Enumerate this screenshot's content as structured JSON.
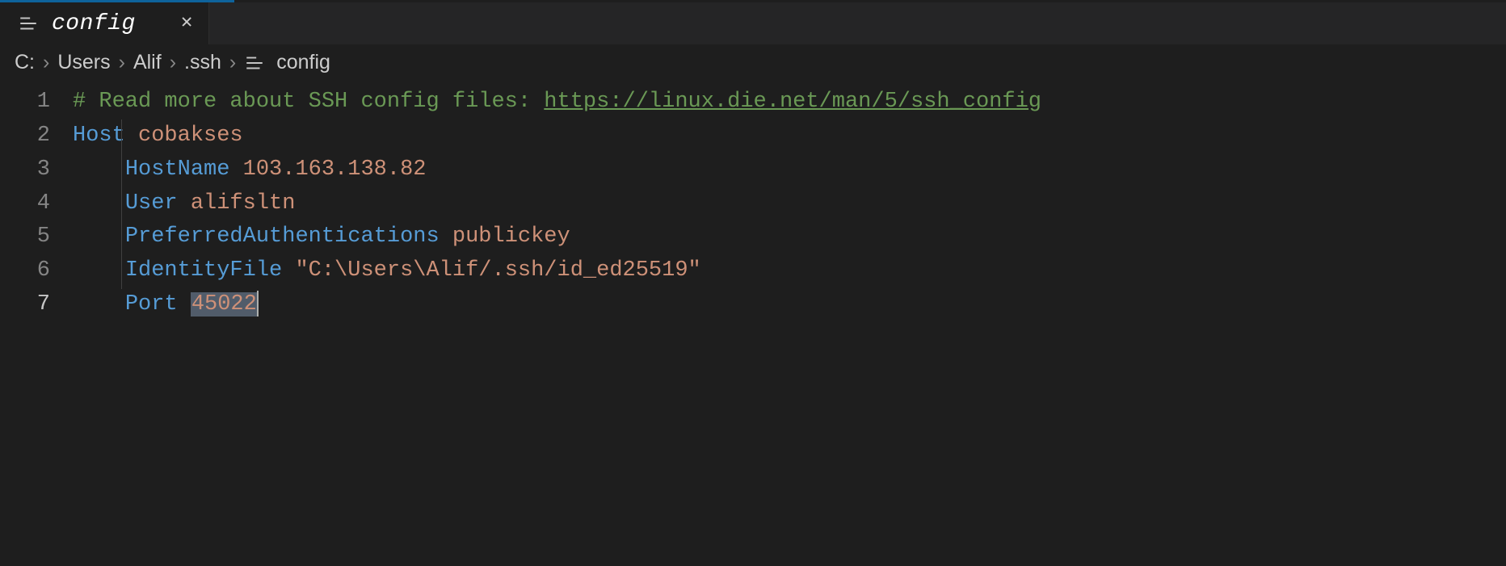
{
  "tab": {
    "filename": "config",
    "icon": "lines-icon"
  },
  "breadcrumb": {
    "segments": [
      "C:",
      "Users",
      "Alif",
      ".ssh"
    ],
    "file": "config",
    "fileIcon": "lines-icon"
  },
  "editor": {
    "activeLine": 7,
    "lines": [
      {
        "num": "1",
        "tokens": [
          {
            "cls": "c-comment",
            "text": "# Read more about SSH config files: "
          },
          {
            "cls": "c-link",
            "text": "https://linux.die.net/man/5/ssh_config"
          }
        ],
        "indent": 0
      },
      {
        "num": "2",
        "tokens": [
          {
            "cls": "c-key",
            "text": "Host"
          },
          {
            "cls": "",
            "text": " "
          },
          {
            "cls": "c-val",
            "text": "cobakses"
          }
        ],
        "indent": 0
      },
      {
        "num": "3",
        "tokens": [
          {
            "cls": "c-key",
            "text": "HostName"
          },
          {
            "cls": "",
            "text": " "
          },
          {
            "cls": "c-val",
            "text": "103.163.138.82"
          }
        ],
        "indent": 1
      },
      {
        "num": "4",
        "tokens": [
          {
            "cls": "c-key",
            "text": "User"
          },
          {
            "cls": "",
            "text": " "
          },
          {
            "cls": "c-val",
            "text": "alifsltn"
          }
        ],
        "indent": 1
      },
      {
        "num": "5",
        "tokens": [
          {
            "cls": "c-key",
            "text": "PreferredAuthentications"
          },
          {
            "cls": "",
            "text": " "
          },
          {
            "cls": "c-val",
            "text": "publickey"
          }
        ],
        "indent": 1
      },
      {
        "num": "6",
        "tokens": [
          {
            "cls": "c-key",
            "text": "IdentityFile"
          },
          {
            "cls": "",
            "text": " "
          },
          {
            "cls": "c-str",
            "text": "\"C:\\Users\\Alif/.ssh/id_ed25519\""
          }
        ],
        "indent": 1
      },
      {
        "num": "7",
        "tokens": [
          {
            "cls": "c-key",
            "text": "Port"
          },
          {
            "cls": "",
            "text": " "
          },
          {
            "cls": "c-val",
            "text": "45022",
            "selected": true
          }
        ],
        "indent": 1,
        "cursorAfter": true
      }
    ]
  }
}
